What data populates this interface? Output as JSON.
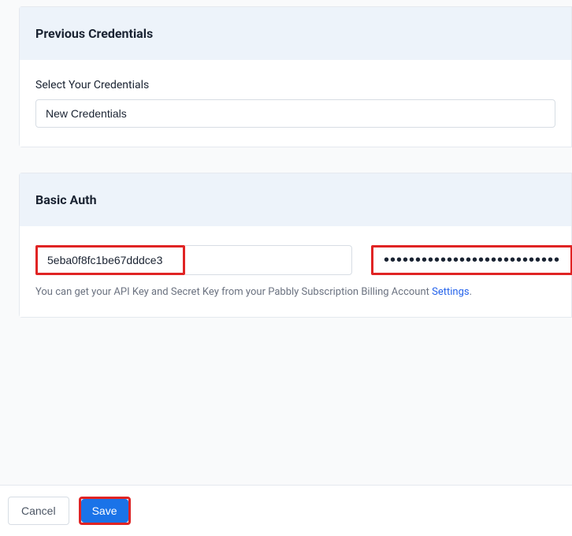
{
  "previous": {
    "title": "Previous Credentials",
    "select_label": "Select Your Credentials",
    "select_value": "New Credentials"
  },
  "auth": {
    "title": "Basic Auth",
    "api_key_value": "5eba0f8fc1be67dddce3",
    "secret_value": "••••••••••••••••••••••••••••",
    "helper_text": "You can get your API Key and Secret Key from your Pabbly Subscription Billing Account ",
    "helper_link": "Settings",
    "helper_suffix": "."
  },
  "footer": {
    "cancel_label": "Cancel",
    "save_label": "Save"
  }
}
